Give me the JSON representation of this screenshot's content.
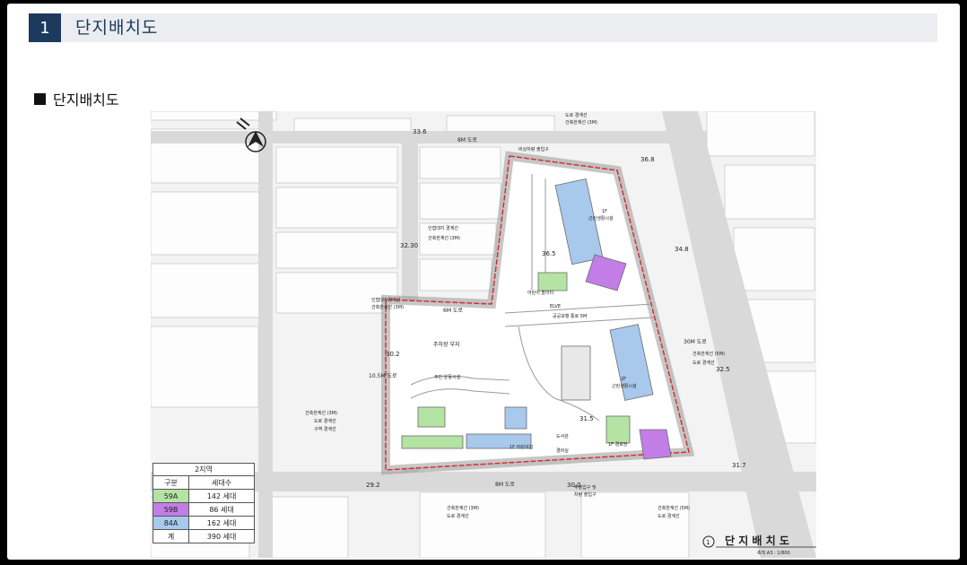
{
  "header": {
    "number": "1",
    "title": "단지배치도"
  },
  "subtitle": "단지배치도",
  "colors": {
    "header_accent": "#1c3a5e",
    "type_59A": "#b5e3a3",
    "type_59B": "#c27ee6",
    "type_84A": "#a8c8ec",
    "site_boundary": "#d9262c"
  },
  "plan": {
    "road_labels": {
      "r8m_top": "8M 도로",
      "r6m": "6M 도로",
      "r30m": "30M 도로",
      "r10m": "10.5M 도로",
      "r8m_bottom": "8M 도로"
    },
    "elevations": {
      "e336": "33.6",
      "e368": "36.8",
      "e3230": "32.30",
      "e348": "34.8",
      "e365": "36.5",
      "e302": "30.2",
      "e325": "32.5",
      "e315": "31.5",
      "e317": "31.7",
      "e292": "29.2",
      "e300": "30.0"
    },
    "annotations": {
      "road_line_top": "도로 경계선",
      "build_line_top": "건축한계선 (3M)",
      "emergency": "비상차량 출입구",
      "adj_line": "인접대지 경계선",
      "build_line_3m": "건축한계선 (3M)",
      "adj_line_b": "인접대지경계선",
      "build_line_b": "건축한계선 (3M)",
      "parking": "주차장 부지",
      "public_walk": "공공보행 통로 5M",
      "bld30_line": "건축한계선 (5M)",
      "road_line_r": "도로 경계선",
      "left_build": "건축한계선 (3M)",
      "left_road": "도로 경계선",
      "left_zone": "구역 경계선",
      "bottom_build": "건축한계선 (3M)",
      "bottom_road": "도로 경계선",
      "br_build": "건축한계선 (5M)",
      "br_road": "도로 경계선",
      "main_entry": "주출입구 및",
      "main_entry2": "차량 출입구",
      "facility_1f_a": "1F",
      "facility_a": "근린생활시설",
      "facility_b": "근린생활시설",
      "facility_2f": "2F",
      "nursery": "1F 어린이집",
      "senior": "1F 경로당",
      "community": "주민 운동시설",
      "playground": "어린이 놀이터",
      "library": "도서관",
      "guard": "경비실",
      "elev_label": "ELVE"
    },
    "title": "단 지 배 치 도",
    "scale": "축척 A3 : 1/800",
    "drawing_no": "1"
  },
  "legend": {
    "title": "2지역",
    "headers": [
      "구분",
      "세대수"
    ],
    "rows": [
      {
        "type": "59A",
        "units": "142 세대"
      },
      {
        "type": "59B",
        "units": "86 세대"
      },
      {
        "type": "84A",
        "units": "162 세대"
      },
      {
        "type": "계",
        "units": "390 세대"
      }
    ]
  }
}
